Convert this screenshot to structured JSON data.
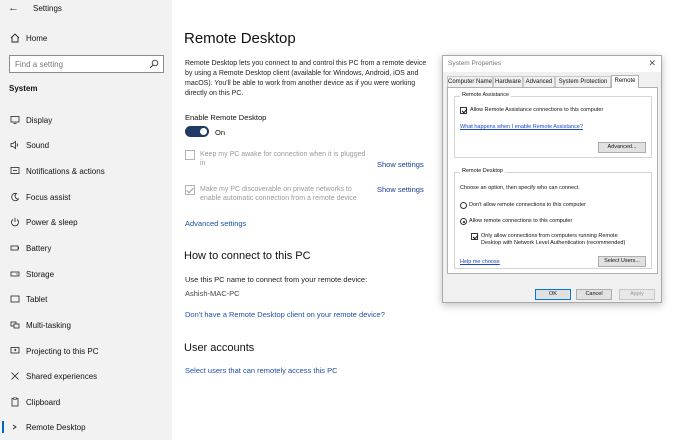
{
  "app": {
    "title": "Settings"
  },
  "sidebar": {
    "home_label": "Home",
    "search_placeholder": "Find a setting",
    "section": "System",
    "items": [
      {
        "label": "Display",
        "icon": "display-icon"
      },
      {
        "label": "Sound",
        "icon": "speaker-icon"
      },
      {
        "label": "Notifications & actions",
        "icon": "notification-icon"
      },
      {
        "label": "Focus assist",
        "icon": "moon-icon"
      },
      {
        "label": "Power & sleep",
        "icon": "power-icon"
      },
      {
        "label": "Battery",
        "icon": "battery-icon"
      },
      {
        "label": "Storage",
        "icon": "storage-icon"
      },
      {
        "label": "Tablet",
        "icon": "tablet-icon"
      },
      {
        "label": "Multi-tasking",
        "icon": "multitasking-icon"
      },
      {
        "label": "Projecting to this PC",
        "icon": "projector-icon"
      },
      {
        "label": "Shared experiences",
        "icon": "shared-icon"
      },
      {
        "label": "Clipboard",
        "icon": "clipboard-icon"
      },
      {
        "label": "Remote Desktop",
        "icon": "remote-desktop-icon",
        "active": true
      }
    ]
  },
  "main": {
    "title": "Remote Desktop",
    "description": "Remote Desktop lets you connect to and control this PC from a remote device by using a Remote Desktop client (available for Windows, Android, iOS and macOS). You'll be able to work from another device as if you were working directly on this PC.",
    "enable_label": "Enable Remote Desktop",
    "toggle_state": "On",
    "option1": "Keep my PC awake for connection when it is plugged in",
    "option2": "Make my PC discoverable on private networks to enable automatic connection from a remote device",
    "show_settings": "Show settings",
    "advanced_settings": "Advanced settings",
    "connect_heading": "How to connect to this PC",
    "connect_text": "Use this PC name to connect from your remote device:",
    "pc_name": "Ashish-MAC-PC",
    "no_client_link": "Don't have a Remote Desktop client on your remote device?",
    "user_accounts_heading": "User accounts",
    "select_users_link": "Select users that can remotely access this PC"
  },
  "dialog": {
    "title": "System Properties",
    "close": "✕",
    "tabs": [
      "Computer Name",
      "Hardware",
      "Advanced",
      "System Protection",
      "Remote"
    ],
    "selected_tab": "Remote",
    "remote_assistance": {
      "group_title": "Remote Assistance",
      "allow_checkbox": "Allow Remote Assistance connections to this computer",
      "help_link": "What happens when I enable Remote Assistance?",
      "advanced_button": "Advanced..."
    },
    "remote_desktop": {
      "group_title": "Remote Desktop",
      "prompt": "Choose an option, then specify who can connect.",
      "radio_dont_allow": "Don't allow remote connections to this computer",
      "radio_allow": "Allow remote connections to this computer",
      "nla_line1": "Only allow connections from computers running Remote",
      "nla_line2": "Desktop with Network Level Authentication (recommended)",
      "help_link": "Help me choose",
      "select_users_button": "Select Users..."
    },
    "buttons": {
      "ok": "OK",
      "cancel": "Cancel",
      "apply": "Apply"
    }
  }
}
